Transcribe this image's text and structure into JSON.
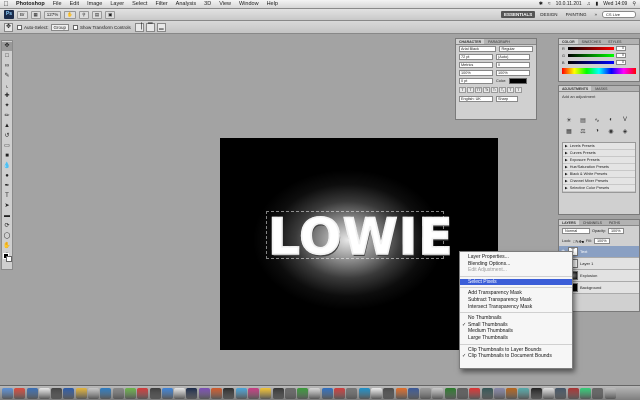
{
  "menubar": {
    "apple": "",
    "app_name": "Photoshop",
    "items": [
      "File",
      "Edit",
      "Image",
      "Layer",
      "Select",
      "Filter",
      "Analysis",
      "3D",
      "View",
      "Window",
      "Help"
    ],
    "status_ip": "10.0.11.201",
    "clock": "Wed 14:09"
  },
  "appbar": {
    "logo": "Ps",
    "zoom": "127%",
    "workspaces": [
      "ESSENTIALS",
      "DESIGN",
      "PAINTING"
    ],
    "more": "»",
    "search_placeholder": "CS Live"
  },
  "options": {
    "auto_select_label": "Auto-Select:",
    "auto_select_value": "Group",
    "show_transform_label": "Show Transform Controls"
  },
  "toolbox": {
    "tools": [
      "move",
      "marquee",
      "lasso",
      "quick-select",
      "crop",
      "eyedropper",
      "healing",
      "brush",
      "stamp",
      "history-brush",
      "eraser",
      "gradient",
      "blur",
      "dodge",
      "pen",
      "type",
      "path-select",
      "shape",
      "3d-rotate",
      "3d-orbit",
      "hand",
      "zoom"
    ]
  },
  "canvas": {
    "text": "LOWIE"
  },
  "character_panel": {
    "tabs": [
      "CHARACTER",
      "PARAGRAPH"
    ],
    "font_family": "Arial Black",
    "font_style": "Regular",
    "size": "72 pt",
    "leading": "(Auto)",
    "kerning": "Metrics",
    "tracking": "0",
    "vscale": "100%",
    "hscale": "100%",
    "baseline": "0 pt",
    "color_label": "Color:",
    "language": "English: UK",
    "antialias": "Sharp",
    "style_buttons": [
      "T",
      "T",
      "TT",
      "Tt",
      "T¹",
      "T₁",
      "T",
      "T"
    ]
  },
  "color_panel": {
    "tabs": [
      "COLOR",
      "SWATCHES",
      "STYLES"
    ],
    "r_label": "R",
    "g_label": "G",
    "b_label": "B",
    "r": "0",
    "g": "0",
    "b": "0"
  },
  "adjustments_panel": {
    "tabs": [
      "ADJUSTMENTS",
      "MASKS"
    ],
    "title": "Add an adjustment",
    "presets": [
      "Levels Presets",
      "Curves Presets",
      "Exposure Presets",
      "Hue/Saturation Presets",
      "Black & White Presets",
      "Channel Mixer Presets",
      "Selective Color Presets"
    ]
  },
  "layers_panel": {
    "tabs": [
      "LAYERS",
      "CHANNELS",
      "PATHS"
    ],
    "blend_mode": "Normal",
    "opacity_label": "Opacity:",
    "opacity": "100%",
    "lock_label": "Lock:",
    "fill_label": "Fill:",
    "fill": "100%",
    "layers": [
      {
        "name": "Text",
        "thumb": "T"
      },
      {
        "name": "Layer 1",
        "thumb": ""
      },
      {
        "name": "Explosion",
        "thumb": ""
      },
      {
        "name": "Background",
        "thumb": ""
      }
    ]
  },
  "context_menu": {
    "items": [
      {
        "label": "Layer Properties...",
        "state": "normal"
      },
      {
        "label": "Blending Options...",
        "state": "normal"
      },
      {
        "label": "Edit Adjustment...",
        "state": "disabled"
      },
      {
        "sep": true
      },
      {
        "label": "Select Pixels",
        "state": "highlighted"
      },
      {
        "sep": true
      },
      {
        "label": "Add Transparency Mask",
        "state": "normal"
      },
      {
        "label": "Subtract Transparency Mask",
        "state": "normal"
      },
      {
        "label": "Intersect Transparency Mask",
        "state": "normal"
      },
      {
        "sep": true
      },
      {
        "label": "No Thumbnails",
        "state": "normal"
      },
      {
        "label": "Small Thumbnails",
        "state": "checked"
      },
      {
        "label": "Medium Thumbnails",
        "state": "normal"
      },
      {
        "label": "Large Thumbnails",
        "state": "normal"
      },
      {
        "sep": true
      },
      {
        "label": "Clip Thumbnails to Layer Bounds",
        "state": "normal"
      },
      {
        "label": "Clip Thumbnails to Document Bounds",
        "state": "checked"
      }
    ]
  },
  "dock": {
    "colors": [
      "#5b8fd6",
      "#d94a3c",
      "#3a6fb5",
      "#e8e8e8",
      "#444",
      "#2b5aa8",
      "#e2b33a",
      "#c8c8c8",
      "#2d7cc1",
      "#888",
      "#6bb34a",
      "#d23b3b",
      "#3e3e3e",
      "#3c82d8",
      "#e6e6e6",
      "#1b2b4a",
      "#7c4fb5",
      "#d05a2b",
      "#2b2b2b",
      "#4aa4d8",
      "#c83c83",
      "#f2c233",
      "#333",
      "#6a6a6a",
      "#3a9a3a",
      "#d8d8d8",
      "#2f6fc0",
      "#ce3d3d",
      "#777",
      "#1e90c8",
      "#ececec",
      "#4a4a4a",
      "#e06d2a",
      "#3b5998",
      "#9a9a9a",
      "#c9c9c9",
      "#2a7a2a",
      "#5e5e5e",
      "#d33",
      "#355",
      "#88a",
      "#b5651d",
      "#5aa",
      "#222",
      "#e0e0e0",
      "#456",
      "#a33",
      "#3c7",
      "#666",
      "#bbb"
    ]
  }
}
